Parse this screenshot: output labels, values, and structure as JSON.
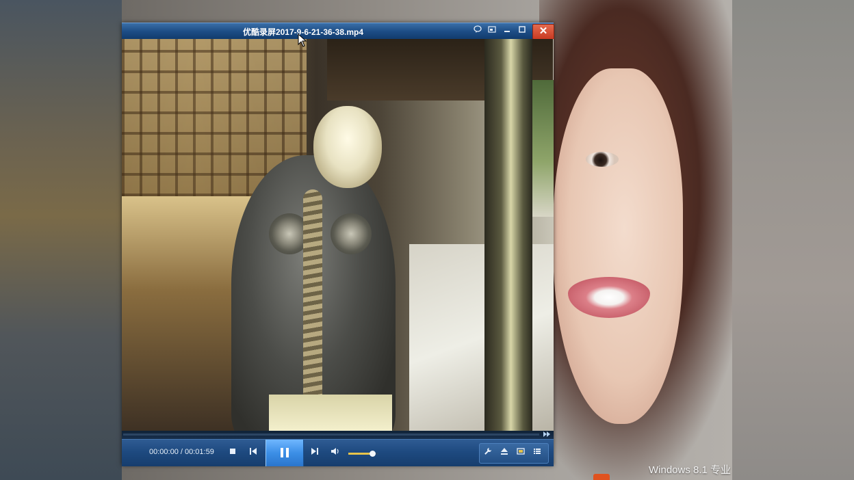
{
  "player": {
    "title": "优酷录屏2017-9-6-21-36-38.mp4",
    "titlebar_icons": [
      "chat-bubble-icon",
      "miniplayer-icon",
      "minimize-icon",
      "maximize-icon",
      "close-icon"
    ],
    "close_glyph": "✕",
    "time_current": "00:00:00",
    "time_separator": " / ",
    "time_total": "00:01:59",
    "playback_progress": 0.0,
    "volume_level": 0.8,
    "state": "playing",
    "controls": [
      "stop-icon",
      "previous-icon",
      "pause-icon",
      "next-icon",
      "volume-icon"
    ],
    "tools": [
      "wrench-icon",
      "eject-icon",
      "screen-icon",
      "playlist-icon"
    ]
  },
  "desktop": {
    "watermark": "Windows 8.1 专业"
  },
  "colors": {
    "titlebar": "#1d4d85",
    "close": "#c93a22",
    "play_button": "#3c8fe6",
    "volume_fill": "#e7c34a",
    "seek_fill": "#8fd0ff"
  }
}
